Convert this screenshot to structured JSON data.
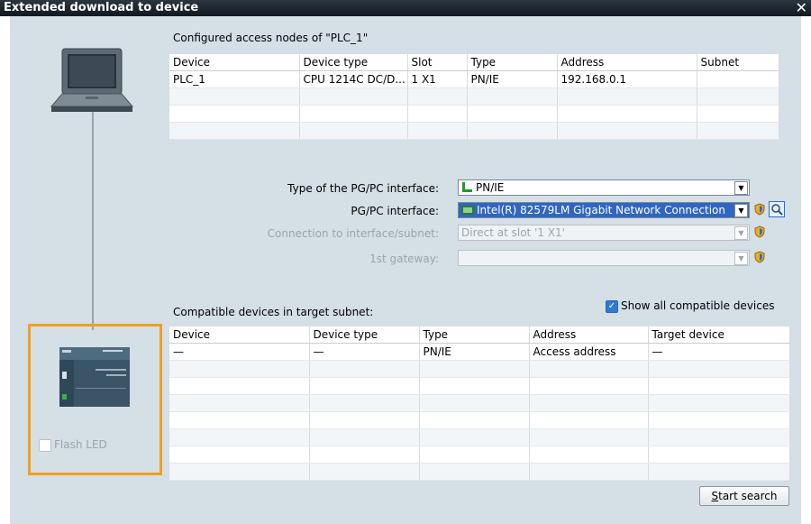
{
  "window": {
    "title": "Extended download to device",
    "close_glyph": "✕"
  },
  "configured": {
    "heading": "Configured access nodes of \"PLC_1\"",
    "columns": [
      "Device",
      "Device type",
      "Slot",
      "Type",
      "Address",
      "Subnet"
    ],
    "rows": [
      [
        "PLC_1",
        "CPU 1214C DC/D...",
        "1 X1",
        "PN/IE",
        "192.168.0.1",
        ""
      ],
      [
        "",
        "",
        "",
        "",
        "",
        ""
      ],
      [
        "",
        "",
        "",
        "",
        "",
        ""
      ],
      [
        "",
        "",
        "",
        "",
        "",
        ""
      ]
    ]
  },
  "interface": {
    "type_label": "Type of the PG/PC interface:",
    "type_value": "PN/IE",
    "pgpc_label": "PG/PC interface:",
    "pgpc_value": "Intel(R) 82579LM Gigabit Network Connection",
    "conn_label": "Connection to interface/subnet:",
    "conn_value": "Direct at slot '1 X1'",
    "gateway_label": "1st gateway:",
    "gateway_value": ""
  },
  "compatible": {
    "heading": "Compatible devices in target subnet:",
    "show_all_label": "Show all compatible devices",
    "show_all_checked": true,
    "columns": [
      "Device",
      "Device type",
      "Type",
      "Address",
      "Target device"
    ],
    "rows": [
      [
        "—",
        "—",
        "PN/IE",
        "Access address",
        "—"
      ],
      [
        "",
        "",
        "",
        "",
        ""
      ],
      [
        "",
        "",
        "",
        "",
        ""
      ],
      [
        "",
        "",
        "",
        "",
        ""
      ],
      [
        "",
        "",
        "",
        "",
        ""
      ],
      [
        "",
        "",
        "",
        "",
        ""
      ],
      [
        "",
        "",
        "",
        "",
        ""
      ],
      [
        "",
        "",
        "",
        "",
        ""
      ]
    ]
  },
  "flash_led": {
    "label": "Flash LED",
    "checked": false
  },
  "start_search": {
    "label": "Start search",
    "mnemonic": "S",
    "rest": "tart search"
  },
  "colors": {
    "highlight_frame": "#f0a020",
    "selection": "#2f66c2",
    "panel": "#d4dfe6"
  }
}
